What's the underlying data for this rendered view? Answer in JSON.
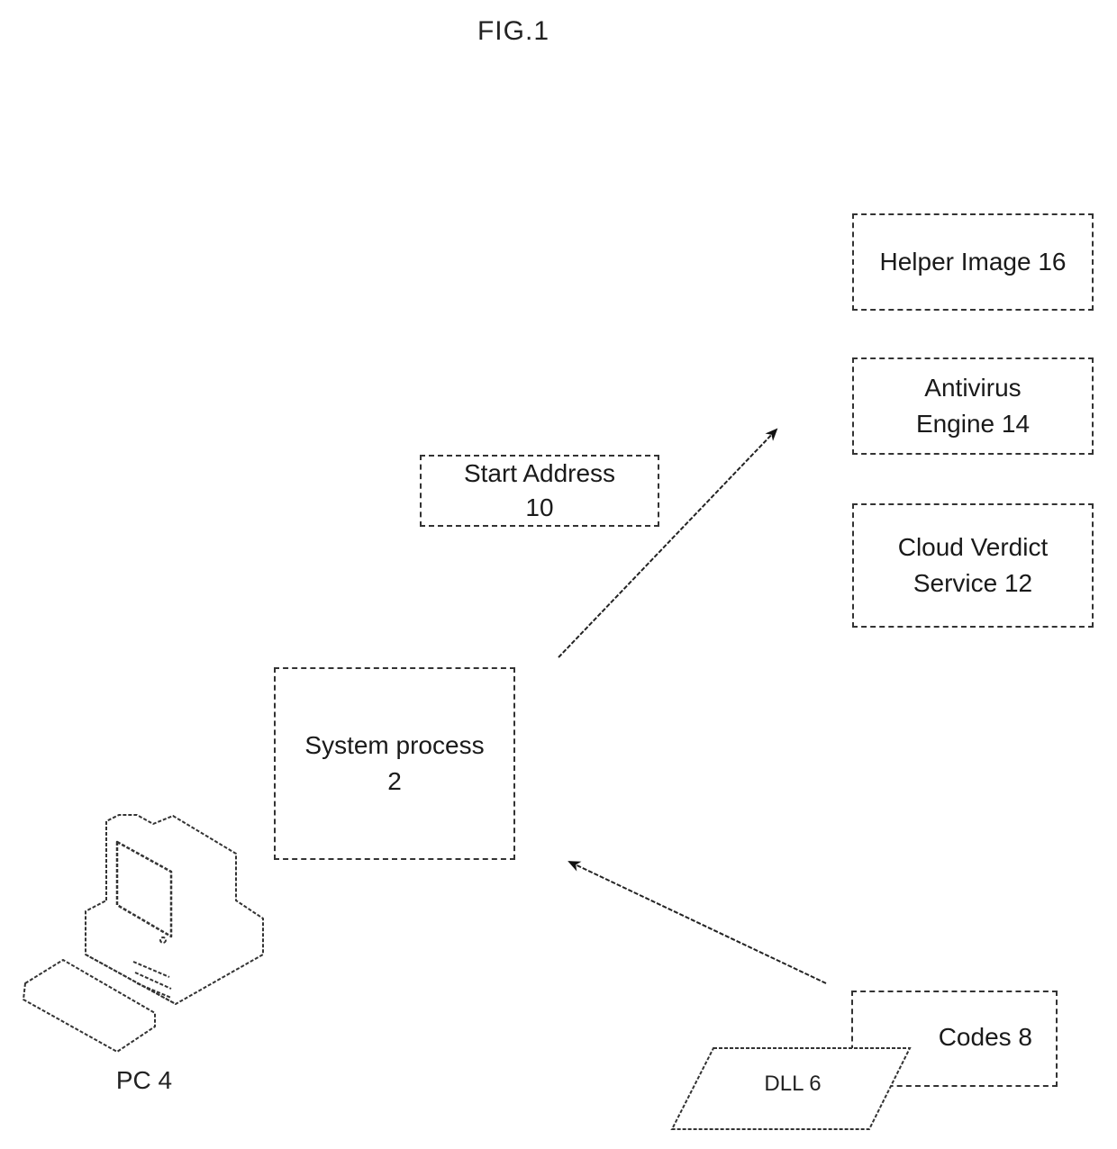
{
  "figure": {
    "title": "FIG.1"
  },
  "nodes": {
    "helper_image": {
      "line1": "Helper Image 16"
    },
    "antivirus_engine": {
      "line1": "Antivirus",
      "line2": "Engine 14"
    },
    "cloud_verdict": {
      "line1": "Cloud Verdict",
      "line2": "Service 12"
    },
    "start_address": {
      "line1": "Start Address",
      "line2": "10"
    },
    "system_process": {
      "line1": "System process",
      "line2": "2"
    },
    "codes": {
      "line1": "Codes 8"
    },
    "dll": {
      "line1": "DLL 6"
    },
    "pc": {
      "label": "PC 4"
    }
  },
  "edges": [
    {
      "from": "system_process",
      "to": "antivirus_engine",
      "type": "arrow"
    },
    {
      "from": "codes",
      "to": "system_process",
      "type": "arrow"
    }
  ]
}
